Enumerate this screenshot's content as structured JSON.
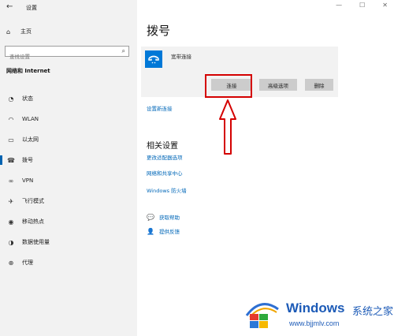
{
  "window": {
    "back_glyph": "←",
    "title": "设置",
    "minimize_glyph": "—",
    "maximize_glyph": "☐",
    "close_glyph": "✕"
  },
  "sidebar": {
    "home_label": "主页",
    "search_placeholder": "查找设置",
    "section_title": "网络和 Internet",
    "items": [
      {
        "label": "状态",
        "icon": "status-icon",
        "glyph": "◔"
      },
      {
        "label": "WLAN",
        "icon": "wifi-icon",
        "glyph": "◠"
      },
      {
        "label": "以太网",
        "icon": "ethernet-icon",
        "glyph": "▭"
      },
      {
        "label": "拨号",
        "icon": "dialup-icon",
        "glyph": "☎"
      },
      {
        "label": "VPN",
        "icon": "vpn-icon",
        "glyph": "∞"
      },
      {
        "label": "飞行模式",
        "icon": "airplane-icon",
        "glyph": "✈"
      },
      {
        "label": "移动热点",
        "icon": "hotspot-icon",
        "glyph": "◉"
      },
      {
        "label": "数据使用量",
        "icon": "data-usage-icon",
        "glyph": "◑"
      },
      {
        "label": "代理",
        "icon": "proxy-icon",
        "glyph": "⊕"
      }
    ],
    "active_index": 3
  },
  "main": {
    "title": "拨号",
    "connection": {
      "name": "宽带连接",
      "connect_label": "连接",
      "advanced_label": "高级选项",
      "delete_label": "删除"
    },
    "setup_link": "设置新连接",
    "related_title": "相关设置",
    "related_links": [
      "更改适配器选项",
      "网络和共享中心",
      "Windows 防火墙"
    ],
    "help": {
      "get_help": "获取帮助",
      "feedback": "提供反馈"
    }
  },
  "watermark": {
    "brand": "Windows",
    "subtitle": "系统之家",
    "url": "www.bjjmlv.com"
  },
  "colors": {
    "accent": "#0078d7",
    "link": "#0067b8",
    "highlight": "#d40000",
    "sidebar_bg": "#f2f2f2",
    "button_bg": "#cccccc"
  }
}
